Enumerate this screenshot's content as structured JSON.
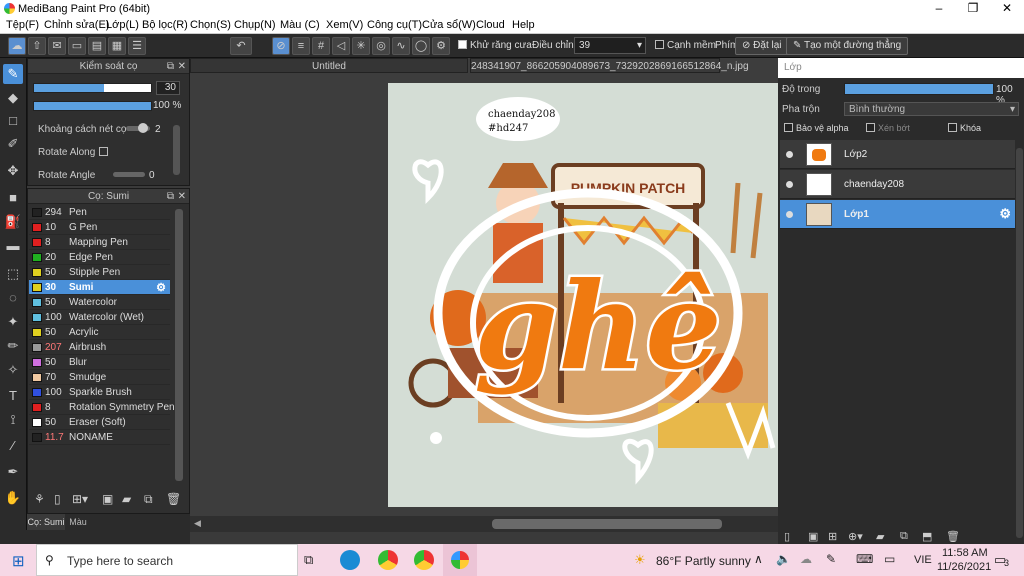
{
  "window": {
    "title": "MediBang Paint Pro (64bit)",
    "min": "–",
    "max": "❐",
    "close": "✕"
  },
  "menu": [
    "Tệp(F)",
    "Chỉnh sửa(E)",
    "Lớp(L)",
    "Bộ lọc(R)",
    "Chọn(S)",
    "Chụp(N)",
    "Màu (C)",
    "Xem(V)",
    "Công cụ(T)",
    "Cửa sổ(W)",
    "Cloud",
    "Help"
  ],
  "toolbar": {
    "antialias": "Khử răng cưa",
    "adjust_label": "Điều chỉnh",
    "adjust_value": "39",
    "smooth": "Cạnh mềm",
    "phim": "Phím",
    "reset": "Đặt lại",
    "straight": "Tạo một đường thẳng"
  },
  "brush_control": {
    "title": "Kiểm soát cọ",
    "size": "30",
    "opacity": "100 %",
    "size_fraction": 0.6,
    "opacity_fraction": 1.0,
    "spacing_label": "Khoảng cách nét cọ",
    "spacing_value": "2",
    "rotate_along": "Rotate Along",
    "rotate_angle": "Rotate Angle",
    "rotate_value": "0"
  },
  "brush_panel": {
    "title": "Cọ: Sumi",
    "items": [
      {
        "size": "294",
        "name": "Pen",
        "color": "#222222"
      },
      {
        "size": "10",
        "name": "G Pen",
        "color": "#e02020"
      },
      {
        "size": "8",
        "name": "Mapping Pen",
        "color": "#e02020"
      },
      {
        "size": "20",
        "name": "Edge Pen",
        "color": "#20b020"
      },
      {
        "size": "50",
        "name": "Stipple Pen",
        "color": "#e0d020"
      },
      {
        "size": "30",
        "name": "Sumi",
        "color": "#e0d020",
        "selected": true
      },
      {
        "size": "50",
        "name": "Watercolor",
        "color": "#60c0e0"
      },
      {
        "size": "100",
        "name": "Watercolor (Wet)",
        "color": "#60c0e0"
      },
      {
        "size": "50",
        "name": "Acrylic",
        "color": "#e0d020"
      },
      {
        "size": "207",
        "name": "Airbrush",
        "color": "#999999",
        "size_color": "#ff7777"
      },
      {
        "size": "50",
        "name": "Blur",
        "color": "#d070e0"
      },
      {
        "size": "70",
        "name": "Smudge",
        "color": "#f0c8a0"
      },
      {
        "size": "100",
        "name": "Sparkle Brush",
        "color": "#3050e0"
      },
      {
        "size": "8",
        "name": "Rotation Symmetry Pen",
        "color": "#e02020"
      },
      {
        "size": "50",
        "name": "Eraser (Soft)",
        "color": "#ffffff"
      },
      {
        "size": "11.7",
        "name": "NONAME",
        "color": "#222222",
        "size_color": "#ff7777"
      }
    ]
  },
  "bottom_tabs": {
    "brush": "Cọ: Sumi",
    "color": "Màu"
  },
  "canvas": {
    "tab1": "Untitled",
    "tab2": "248341907_866205904089673_7329202869166512864_n.jpg",
    "note1": "chaenday208",
    "note2": "#hd247",
    "sign_text": "PUMPKIN PATCH",
    "big_text": "ghê"
  },
  "layers": {
    "title": "Lớp",
    "opacity_label": "Độ trong",
    "opacity_value": "100 %",
    "blend_label": "Pha trộn",
    "blend_value": "Bình thường",
    "protect_alpha": "Bảo vệ alpha",
    "clipping": "Xén bớt",
    "lock": "Khóa",
    "items": [
      {
        "name": "Lớp2"
      },
      {
        "name": "chaenday208"
      },
      {
        "name": "Lớp1",
        "selected": true
      }
    ]
  },
  "taskbar": {
    "search": "Type here to search",
    "weather": "86°F  Partly sunny",
    "lang": "VIE",
    "time": "11:58 AM",
    "date": "11/26/2021",
    "notif": "3"
  }
}
